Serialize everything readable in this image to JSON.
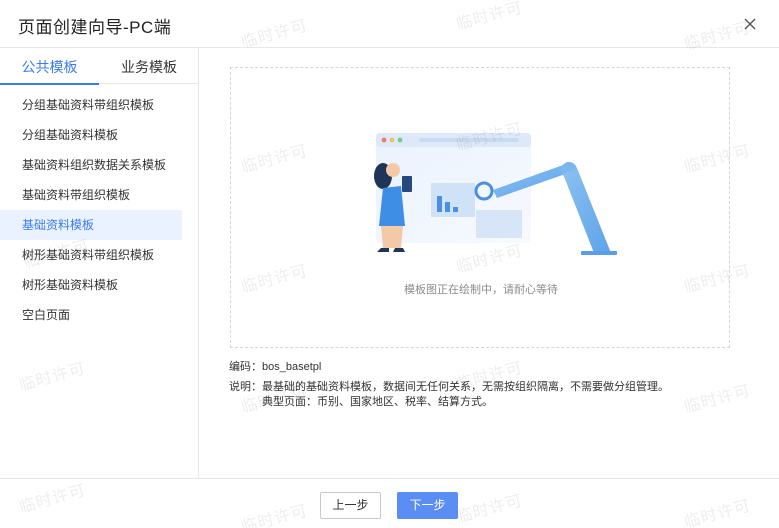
{
  "dialog": {
    "title": "页面创建向导-PC端"
  },
  "tabs": [
    {
      "label": "公共模板",
      "active": true
    },
    {
      "label": "业务模板",
      "active": false
    }
  ],
  "template_list": [
    {
      "label": "分组基础资料带组织模板"
    },
    {
      "label": "分组基础资料模板"
    },
    {
      "label": "基础资料组织数据关系模板"
    },
    {
      "label": "基础资料带组织模板"
    },
    {
      "label": "基础资料模板",
      "selected": true
    },
    {
      "label": "树形基础资料带组织模板"
    },
    {
      "label": "树形基础资料模板"
    },
    {
      "label": "空白页面"
    }
  ],
  "preview": {
    "message": "模板图正在绘制中，请耐心等待"
  },
  "info": {
    "code_label": "编码：",
    "code_value": "bos_basetpl",
    "desc_label": "说明：",
    "desc_line1": "最基础的基础资料模板，数据间无任何关系，无需按组织隔离，不需要做分组管理。",
    "desc_line2": "典型页面：币别、国家地区、税率、结算方式。"
  },
  "footer": {
    "prev_label": "上一步",
    "next_label": "下一步"
  },
  "watermark": {
    "text": "临时许可"
  },
  "colors": {
    "accent": "#3b7cf0",
    "primary_button": "#5a8ef5",
    "selected_bg": "#eaf2ff"
  },
  "icons": {
    "close": "close-icon"
  }
}
